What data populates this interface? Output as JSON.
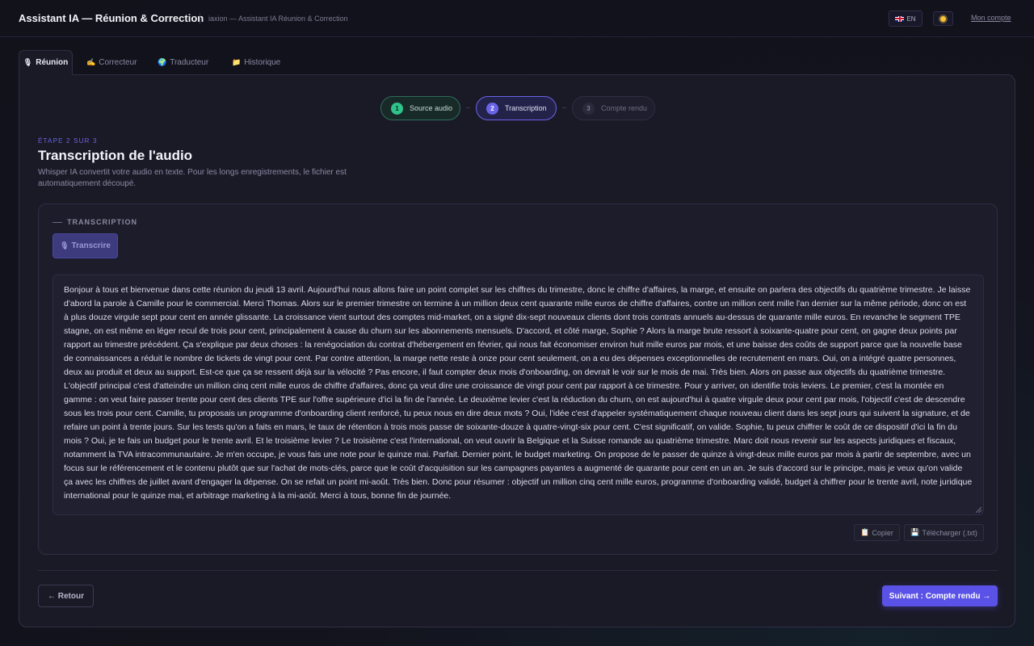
{
  "header": {
    "title": "Assistant IA — Réunion & Correction",
    "subtitle": "iaxion — Assistant IA Réunion & Correction",
    "lang_label": "EN",
    "account_label": "Mon compte"
  },
  "tabs": [
    {
      "label": "Réunion",
      "icon": "mic-icon",
      "active": true
    },
    {
      "label": "Correcteur",
      "icon": "writing-hand-icon",
      "active": false
    },
    {
      "label": "Traducteur",
      "icon": "globe-icon",
      "active": false
    },
    {
      "label": "Historique",
      "icon": "folder-icon",
      "active": false
    }
  ],
  "stepper": [
    {
      "num": "1",
      "label": "Source audio",
      "state": "done"
    },
    {
      "num": "2",
      "label": "Transcription",
      "state": "current"
    },
    {
      "num": "3",
      "label": "Compte rendu",
      "state": "pending"
    }
  ],
  "step_header": {
    "eyebrow": "ÉTAPE 2 SUR 3",
    "title": "Transcription de l'audio",
    "description": "Whisper IA convertit votre audio en texte. Pour les longs enregistrements, le fichier est automatiquement découpé."
  },
  "transcription": {
    "section_label": "TRANSCRIPTION",
    "transcribe_button": "Transcrire",
    "text": "Bonjour à tous et bienvenue dans cette réunion du jeudi 13 avril. Aujourd'hui nous allons faire un point complet sur les chiffres du trimestre, donc le chiffre d'affaires, la marge, et ensuite on parlera des objectifs du quatrième trimestre. Je laisse d'abord la parole à Camille pour le commercial. Merci Thomas. Alors sur le premier trimestre on termine à un million deux cent quarante mille euros de chiffre d'affaires, contre un million cent mille l'an dernier sur la même période, donc on est à plus douze virgule sept pour cent en année glissante. La croissance vient surtout des comptes mid-market, on a signé dix-sept nouveaux clients dont trois contrats annuels au-dessus de quarante mille euros. En revanche le segment TPE stagne, on est même en léger recul de trois pour cent, principalement à cause du churn sur les abonnements mensuels. D'accord, et côté marge, Sophie ? Alors la marge brute ressort à soixante-quatre pour cent, on gagne deux points par rapport au trimestre précédent. Ça s'explique par deux choses : la renégociation du contrat d'hébergement en février, qui nous fait économiser environ huit mille euros par mois, et une baisse des coûts de support parce que la nouvelle base de connaissances a réduit le nombre de tickets de vingt pour cent. Par contre attention, la marge nette reste à onze pour cent seulement, on a eu des dépenses exceptionnelles de recrutement en mars. Oui, on a intégré quatre personnes, deux au produit et deux au support. Est-ce que ça se ressent déjà sur la vélocité ? Pas encore, il faut compter deux mois d'onboarding, on devrait le voir sur le mois de mai. Très bien. Alors on passe aux objectifs du quatrième trimestre. L'objectif principal c'est d'atteindre un million cinq cent mille euros de chiffre d'affaires, donc ça veut dire une croissance de vingt pour cent par rapport à ce trimestre. Pour y arriver, on identifie trois leviers. Le premier, c'est la montée en gamme : on veut faire passer trente pour cent des clients TPE sur l'offre supérieure d'ici la fin de l'année. Le deuxième levier c'est la réduction du churn, on est aujourd'hui à quatre virgule deux pour cent par mois, l'objectif c'est de descendre sous les trois pour cent. Camille, tu proposais un programme d'onboarding client renforcé, tu peux nous en dire deux mots ? Oui, l'idée c'est d'appeler systématiquement chaque nouveau client dans les sept jours qui suivent la signature, et de refaire un point à trente jours. Sur les tests qu'on a faits en mars, le taux de rétention à trois mois passe de soixante-douze à quatre-vingt-six pour cent. C'est significatif, on valide. Sophie, tu peux chiffrer le coût de ce dispositif d'ici la fin du mois ? Oui, je te fais un budget pour le trente avril. Et le troisième levier ? Le troisième c'est l'international, on veut ouvrir la Belgique et la Suisse romande au quatrième trimestre. Marc doit nous revenir sur les aspects juridiques et fiscaux, notamment la TVA intracommunautaire. Je m'en occupe, je vous fais une note pour le quinze mai. Parfait. Dernier point, le budget marketing. On propose de le passer de quinze à vingt-deux mille euros par mois à partir de septembre, avec un focus sur le référencement et le contenu plutôt que sur l'achat de mots-clés, parce que le coût d'acquisition sur les campagnes payantes a augmenté de quarante pour cent en un an. Je suis d'accord sur le principe, mais je veux qu'on valide ça avec les chiffres de juillet avant d'engager la dépense. On se refait un point mi-août. Très bien. Donc pour résumer : objectif un million cinq cent mille euros, programme d'onboarding validé, budget à chiffrer pour le trente avril, note juridique international pour le quinze mai, et arbitrage marketing à la mi-août. Merci à tous, bonne fin de journée.",
    "copy_button": "Copier",
    "download_button": "Télécharger (.txt)"
  },
  "footer": {
    "back_button": "← Retour",
    "next_button": "Suivant : Compte rendu →"
  },
  "colors": {
    "accent": "#5a52e6",
    "success": "#2ec48a",
    "background": "#13131d",
    "panel": "#1a1a27"
  }
}
